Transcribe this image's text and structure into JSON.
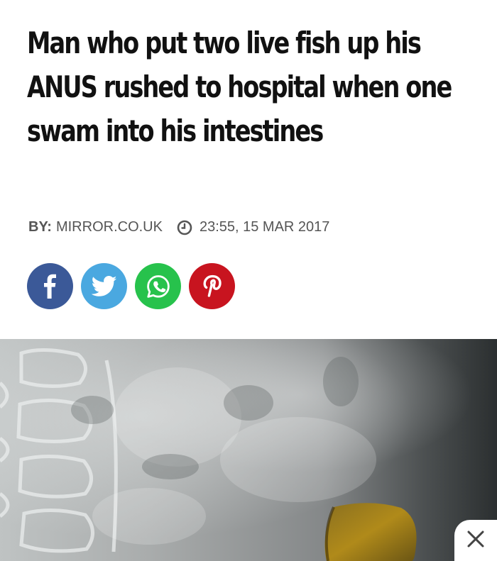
{
  "article": {
    "headline": "Man who put two live fish up his ANUS rushed to hospital when one swam into his intestines",
    "byline_label": "BY:",
    "byline_source": "MIRROR.CO.UK",
    "timestamp": "23:55, 15 MAR 2017"
  },
  "share_buttons": [
    {
      "network": "facebook",
      "icon": "facebook-icon",
      "color": "#3b5998"
    },
    {
      "network": "twitter",
      "icon": "twitter-icon",
      "color": "#4aa8e0"
    },
    {
      "network": "whatsapp",
      "icon": "whatsapp-icon",
      "color": "#27c24c"
    },
    {
      "network": "pinterest",
      "icon": "pinterest-icon",
      "color": "#c8141f"
    }
  ],
  "hero_image": {
    "subject": "x-ray"
  },
  "overlay": {
    "close_icon": "close-icon"
  }
}
